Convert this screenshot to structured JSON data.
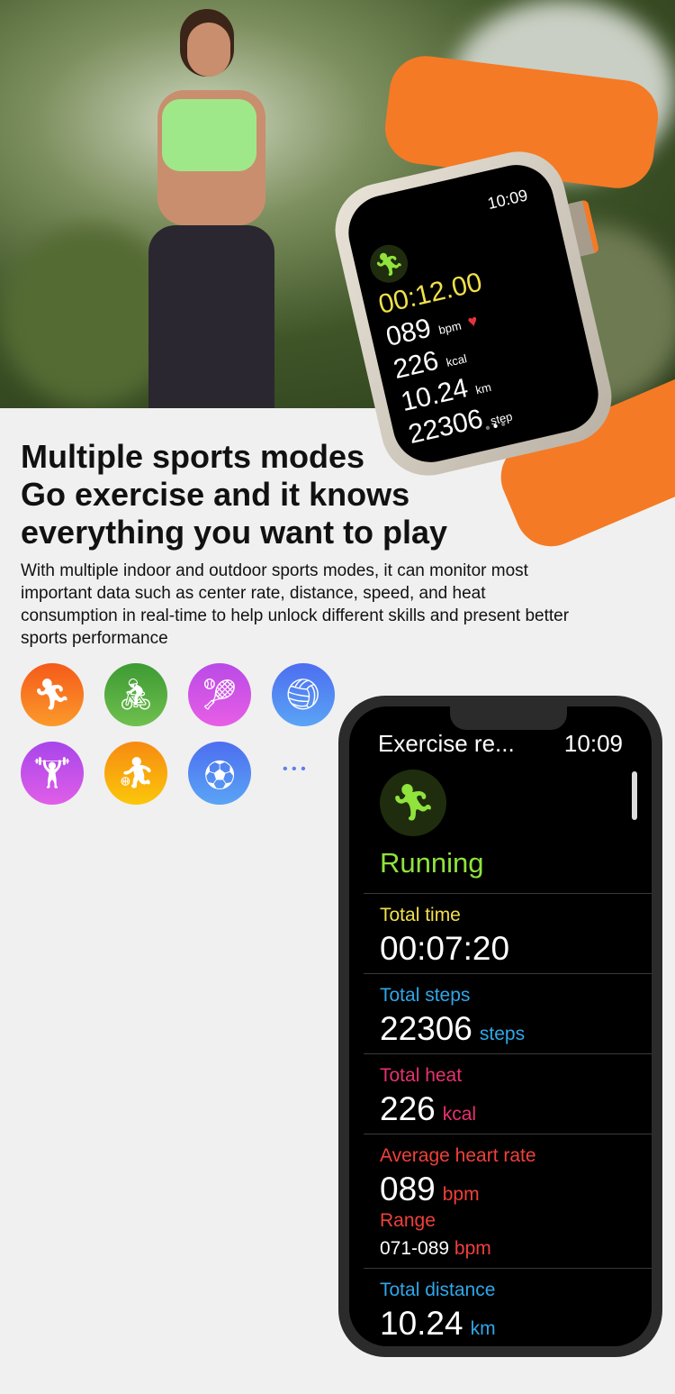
{
  "watch": {
    "time": "10:09",
    "timer": "00:12.00",
    "heart_rate": "089",
    "heart_unit": "bpm",
    "calories": "226",
    "calories_unit": "kcal",
    "distance": "10.24",
    "distance_unit": "km",
    "steps": "22306",
    "steps_unit": "step"
  },
  "headline": [
    "Multiple sports modes",
    "Go exercise and it knows",
    "everything you want to play"
  ],
  "description": "With multiple indoor and outdoor sports modes, it can monitor most important data such as center rate, distance, speed, and heat consumption in real-time to help unlock different skills and present better sports performance",
  "sports": [
    {
      "icon": "running-icon",
      "color": "#f7741a"
    },
    {
      "icon": "cycling-icon",
      "color": "#4fa83c"
    },
    {
      "icon": "tennis-icon",
      "color": "#c04de0"
    },
    {
      "icon": "volleyball-icon",
      "color": "#4d7af0"
    },
    {
      "icon": "weightlifting-icon",
      "color": "#b44ee8"
    },
    {
      "icon": "basketball-icon",
      "color": "#f7a510"
    },
    {
      "icon": "football-icon",
      "color": "#4d7af0"
    }
  ],
  "more": "• • •",
  "phone": {
    "title": "Exercise re...",
    "time": "10:09",
    "activity": "Running",
    "total_time": {
      "label": "Total time",
      "value": "00:07:20"
    },
    "total_steps": {
      "label": "Total steps",
      "value": "22306",
      "unit": "steps"
    },
    "total_heat": {
      "label": "Total heat",
      "value": "226",
      "unit": "kcal"
    },
    "avg_heart": {
      "label": "Average heart rate",
      "value": "089",
      "unit": "bpm",
      "range_label": "Range",
      "range": "071-089",
      "range_unit": "bpm"
    },
    "total_distance": {
      "label": "Total distance",
      "value": "10.24",
      "unit": "km"
    }
  },
  "colors": {
    "yellow": "#f1e04a",
    "blue": "#2fa7e8",
    "pink": "#e8326e",
    "red": "#f0403a",
    "green": "#8fe33c"
  }
}
